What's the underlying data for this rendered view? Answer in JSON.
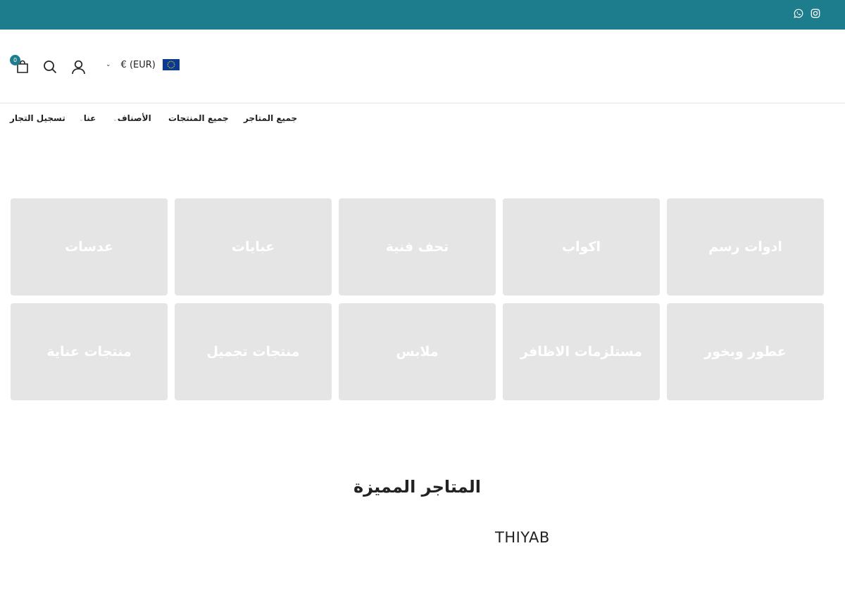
{
  "topbar": {
    "bg_color": "#1d7d8c",
    "icons": [
      "whatsapp-icon",
      "instagram-icon"
    ]
  },
  "header": {
    "cart_count": "0",
    "currency_label": "€ (EUR)",
    "icons": [
      "cart-icon",
      "search-icon",
      "user-icon",
      "chevron-down-icon",
      "eu-flag-icon"
    ]
  },
  "nav": {
    "items": [
      {
        "label": "جميع المتاجر"
      },
      {
        "label": "جميع المنتجات"
      },
      {
        "label": "الأصناف"
      },
      {
        "label": "عنا"
      },
      {
        "label": "تسجيل التجار"
      }
    ]
  },
  "categories": [
    {
      "label": "ادوات رسم"
    },
    {
      "label": "اكواب"
    },
    {
      "label": "تحف فنية"
    },
    {
      "label": "عبايات"
    },
    {
      "label": "عدسات"
    },
    {
      "label": "عطور وبخور"
    },
    {
      "label": "مستلزمات الاظافر"
    },
    {
      "label": "ملابس"
    },
    {
      "label": "منتجات تجميل"
    },
    {
      "label": "منتجات عناية"
    }
  ],
  "featured": {
    "title": "المتاجر المميزة",
    "stores": [
      {
        "name": "THIYAB"
      }
    ]
  },
  "colors": {
    "accent": "#1d7d8c",
    "tile_bg": "#e5e5e5"
  }
}
